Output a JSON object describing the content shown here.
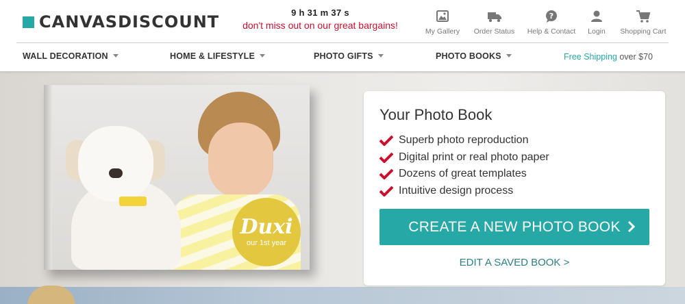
{
  "header": {
    "logo_text": "CANVASDISCOUNT",
    "brand_color": "#26a9a6",
    "timer": "9 h 31 m 37 s",
    "promo": "don't miss out on our great bargains!",
    "icons": [
      {
        "label": "My Gallery",
        "icon": "gallery-icon"
      },
      {
        "label": "Order Status",
        "icon": "truck-icon"
      },
      {
        "label": "Help & Contact",
        "icon": "help-icon"
      },
      {
        "label": "Login",
        "icon": "user-icon"
      },
      {
        "label": "Shopping Cart",
        "icon": "cart-icon"
      }
    ]
  },
  "nav": {
    "items": [
      {
        "label": "WALL DECORATION"
      },
      {
        "label": "HOME & LIFESTYLE"
      },
      {
        "label": "PHOTO GIFTS"
      },
      {
        "label": "PHOTO BOOKS"
      }
    ],
    "shipping_highlight": "Free Shipping",
    "shipping_rest": " over $70"
  },
  "hero": {
    "book_badge_title": "Duxi",
    "book_badge_sub": "our 1st year",
    "panel_title": "Your Photo Book",
    "features": [
      "Superb photo reproduction",
      "Digital print or real photo paper",
      "Dozens of great templates",
      "Intuitive design process"
    ],
    "cta_label": "CREATE A NEW PHOTO BOOK",
    "edit_label": "EDIT A SAVED BOOK >",
    "check_color": "#c8102e"
  }
}
